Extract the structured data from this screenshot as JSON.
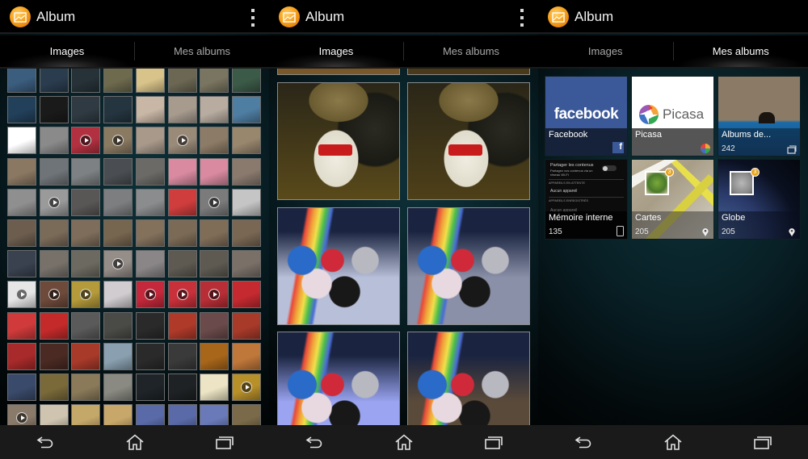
{
  "app": {
    "title": "Album",
    "icon": "album-app-icon",
    "menu_icon": "overflow-menu-icon"
  },
  "tabs": [
    {
      "label": "Images"
    },
    {
      "label": "Mes albums"
    }
  ],
  "panels": [
    {
      "active_tab": "Images",
      "view": "grid-small",
      "show_overflow_menu": true
    },
    {
      "active_tab": "Images",
      "view": "grid-large",
      "show_overflow_menu": true
    },
    {
      "active_tab": "Mes albums",
      "view": "albums",
      "show_overflow_menu": false
    }
  ],
  "thumbnails_small": {
    "columns": 8,
    "rows": [
      {
        "colors": [
          "#3b5d7e",
          "#2a3d4f",
          "#263238",
          "#6d6a4e",
          "#d8c38a",
          "#6b6753",
          "#7a7560",
          "#3c5a48"
        ],
        "video": []
      },
      {
        "colors": [
          "#22405a",
          "#1a1a1a",
          "#2f3a42",
          "#24353f",
          "#c9b7a6",
          "#a79b8e",
          "#b8aca0",
          "#4f7ea3"
        ],
        "video": []
      },
      {
        "colors": [
          "#ffffff",
          "#8a8a8a",
          "#b23140",
          "#8a7a62",
          "#a8998a",
          "#9a8a78",
          "#8c7b66",
          "#98866d"
        ],
        "video": [
          2,
          3,
          5
        ]
      },
      {
        "colors": [
          "#8a7862",
          "#6f7478",
          "#7d8183",
          "#4a4e52",
          "#6b6a66",
          "#d98aa0",
          "#d98aa0",
          "#8a7a6e"
        ],
        "video": []
      },
      {
        "colors": [
          "#8f8f8f",
          "#9a9a9a",
          "#595755",
          "#7c7e80",
          "#8a8c8e",
          "#cf3d3d",
          "#7b7b7b",
          "#c5c5c5"
        ],
        "video": [
          1,
          6
        ]
      },
      {
        "colors": [
          "#6c5d4e",
          "#7a6a58",
          "#7e6d5a",
          "#76654f",
          "#83715c",
          "#7b6a55",
          "#806d58",
          "#796753"
        ],
        "video": []
      },
      {
        "colors": [
          "#3a4250",
          "#77716a",
          "#6c6a60",
          "#958d88",
          "#8a8688",
          "#5e5a52",
          "#5e5a52",
          "#7a7068"
        ],
        "video": [
          3
        ]
      },
      {
        "colors": [
          "#e6e6e6",
          "#6e4a3a",
          "#b49a3a",
          "#d0ccd0",
          "#c4283a",
          "#c8303a",
          "#b82e36",
          "#c42a30"
        ],
        "video": [
          0,
          1,
          2,
          4,
          5,
          6
        ]
      },
      {
        "colors": [
          "#d03a3a",
          "#c42a2a",
          "#5a5a5a",
          "#4a4a46",
          "#2a2a2a",
          "#b03a2a",
          "#6a4a4a",
          "#a83a2a"
        ],
        "video": []
      },
      {
        "colors": [
          "#a82a2a",
          "#4a2a22",
          "#a83a2a",
          "#8aa0b0",
          "#2a2a2a",
          "#3a3a3a",
          "#a8661a",
          "#c0783a"
        ],
        "video": []
      },
      {
        "colors": [
          "#3a4a6a",
          "#7a6a3a",
          "#8a7a5a",
          "#8a8a82",
          "#1e2428",
          "#1e2224",
          "#ece4c4",
          "#b8902a"
        ],
        "video": [
          7
        ]
      },
      {
        "colors": [
          "#8a7a6a",
          "#cfc4b0",
          "#c4a86a",
          "#c8a86a",
          "#5a6aa8",
          "#5a6aa8",
          "#6a7ab8",
          "#7a6a4a"
        ],
        "video": [
          0
        ]
      }
    ]
  },
  "thumbnails_large": {
    "items": [
      {
        "subject": "plush-toy-partial",
        "tint": "#7a5a2a"
      },
      {
        "subject": "plush-toy-partial",
        "tint": "#4a3a1a"
      },
      {
        "subject": "plush-toy",
        "tint": "#5a4a1a"
      },
      {
        "subject": "plush-toy",
        "tint": "#4e4018"
      },
      {
        "subject": "android-figures",
        "tint": "#b8bfd8"
      },
      {
        "subject": "android-figures",
        "tint": "#8a90a8"
      },
      {
        "subject": "android-figures",
        "tint": "#9aa4f0"
      },
      {
        "subject": "android-figures",
        "tint": "#5a4a3a"
      }
    ]
  },
  "albums": [
    {
      "name": "Facebook",
      "count": "",
      "badge": "facebook-icon",
      "cover": "facebook"
    },
    {
      "name": "Picasa",
      "count": "",
      "badge": "picasa-icon",
      "cover": "picasa"
    },
    {
      "name": "Albums de...",
      "count": "242",
      "badge": "folder-icon",
      "cover": "photo"
    },
    {
      "name": "Mémoire interne",
      "count": "135",
      "badge": "phone-icon",
      "cover": "settings"
    },
    {
      "name": "Cartes",
      "count": "205",
      "badge": "map-pin-icon",
      "cover": "map",
      "cluster_count": "3"
    },
    {
      "name": "Globe",
      "count": "205",
      "badge": "map-pin-icon",
      "cover": "globe",
      "cluster_count": "3"
    }
  ],
  "cover_text": {
    "facebook_logo": "facebook",
    "picasa_logo": "Picasa",
    "settings_title": "Partager les contenus",
    "settings_sub": "Partagez vos contenus via un réseau Wi-Fi",
    "settings_section1": "APPAREILS EN ATTENTE",
    "settings_item1": "Aucun appareil",
    "settings_section2": "APPAREILS ENREGISTRÉS",
    "settings_item2": "Aucun appareil"
  },
  "navbar": [
    {
      "icon": "back-icon"
    },
    {
      "icon": "home-icon"
    },
    {
      "icon": "recent-apps-icon"
    }
  ],
  "colors": {
    "app_icon": "#f7a21d",
    "facebook_blue": "#3b5998",
    "background_teal": "#0e3038",
    "navbar": "#1a1a1a"
  }
}
